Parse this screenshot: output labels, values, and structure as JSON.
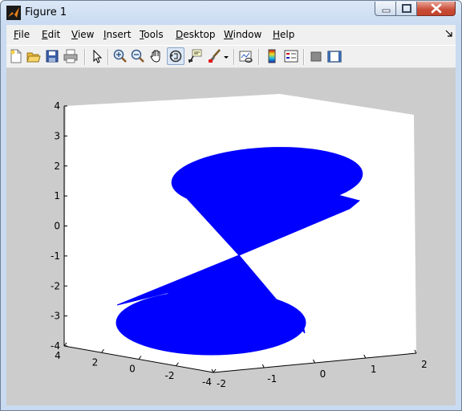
{
  "window": {
    "title": "Figure 1",
    "app_icon": "matlab-icon",
    "controls": [
      "minimize-icon",
      "maximize-icon",
      "close-icon"
    ]
  },
  "menu": {
    "items": [
      {
        "label": "File",
        "mnemonic": "F",
        "rest": "ile"
      },
      {
        "label": "Edit",
        "mnemonic": "E",
        "rest": "dit"
      },
      {
        "label": "View",
        "mnemonic": "V",
        "rest": "iew"
      },
      {
        "label": "Insert",
        "mnemonic": "I",
        "rest": "nsert"
      },
      {
        "label": "Tools",
        "mnemonic": "T",
        "rest": "ools"
      },
      {
        "label": "Desktop",
        "mnemonic": "D",
        "rest": "esktop"
      },
      {
        "label": "Window",
        "mnemonic": "W",
        "rest": "indow"
      },
      {
        "label": "Help",
        "mnemonic": "H",
        "rest": "elp"
      }
    ],
    "dock_icon": "dock-arrow-icon"
  },
  "toolbar": {
    "buttons": [
      "new-figure-icon",
      "open-file-icon",
      "save-icon",
      "print-icon",
      "edit-plot-icon",
      "zoom-in-icon",
      "zoom-out-icon",
      "pan-icon",
      "rotate-3d-icon",
      "data-cursor-icon",
      "brush-icon",
      "brush-dropdown-icon",
      "link-plot-icon",
      "insert-colorbar-icon",
      "insert-legend-icon",
      "hide-plot-tools-icon",
      "show-plot-tools-icon"
    ],
    "active_tool": "rotate-3d-icon"
  },
  "chart_data": {
    "type": "surface-3d",
    "view": "3d rotated",
    "title": "",
    "xlabel": "",
    "ylabel": "",
    "zlabel": "",
    "x_ticks": [
      "-2",
      "-1",
      "0",
      "1",
      "2"
    ],
    "y_ticks": [
      "-4",
      "-2",
      "0",
      "2",
      "4"
    ],
    "z_ticks": [
      "-4",
      "-3",
      "-2",
      "-1",
      "0",
      "1",
      "2",
      "3",
      "4"
    ],
    "xlim": [
      -2,
      2
    ],
    "ylim": [
      -4,
      4
    ],
    "zlim": [
      -4,
      4
    ],
    "grid": false,
    "surface_color": "#0000ff",
    "axes_background": "#ffffff",
    "figure_background": "#cccccc",
    "shape": "double cone (two elliptical discs meeting at origin)"
  }
}
